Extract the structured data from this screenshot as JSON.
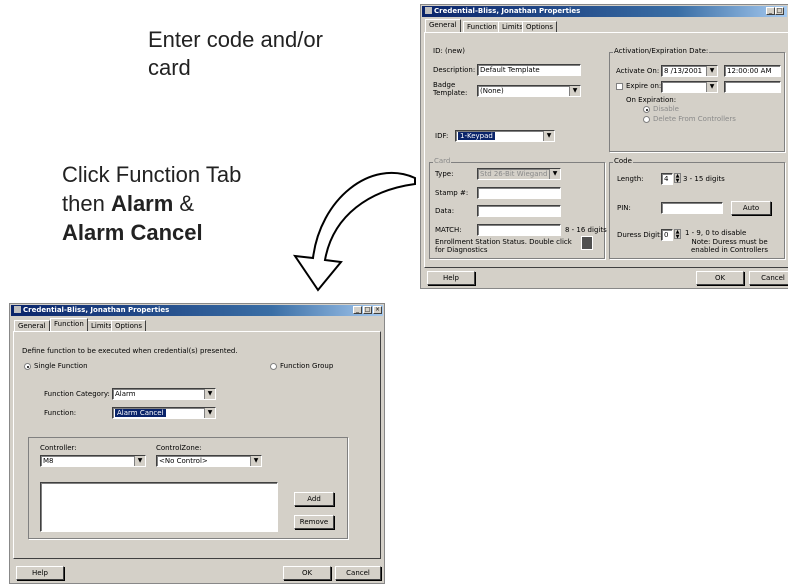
{
  "annotation_top": {
    "line1": "Enter code and/or",
    "line2": "card"
  },
  "annotation_mid": {
    "line1": "Click Function Tab",
    "line2_prefix": "then ",
    "line2_bold": "Alarm",
    "line2_suffix": " &",
    "line3_bold": "Alarm Cancel"
  },
  "general_window": {
    "title": "Credential-Bliss, Jonathan Properties",
    "tabs": [
      "General",
      "Function",
      "Limits",
      "Options"
    ],
    "id_label": "ID: (new)",
    "description_label": "Description:",
    "description_value": "Default Template",
    "badge_label_1": "Badge",
    "badge_label_2": "Template:",
    "badge_value": "(None)",
    "idf_label": "IDF:",
    "idf_value": "1-Keypad",
    "activation_group": "Activation/Expiration Date:",
    "activate_label": "Activate On:",
    "activate_date": "8 /13/2001",
    "activate_time": "12:00:00 AM",
    "expire_label": "Expire on:",
    "on_expiration_label": "On Expiration:",
    "disable_label": "Disable",
    "delete_label": "Delete From Controllers",
    "card_group": "Card",
    "type_label": "Type:",
    "type_value": "Std 26-Bit Wiegand",
    "stamp_label": "Stamp #:",
    "data_label": "Data:",
    "match_label": "MATCH:",
    "match_hint": "8 - 16 digits",
    "enrollment_1": "Enrollment Station Status.  Double click",
    "enrollment_2": "for Diagnostics",
    "code_group": "Code",
    "length_label": "Length:",
    "length_value": "4",
    "length_hint": "3 - 15 digits",
    "pin_label": "PIN:",
    "auto_button": "Auto",
    "duress_label": "Duress Digit:",
    "duress_value": "0",
    "duress_hint": "1 - 9, 0 to disable",
    "duress_note_1": "Note: Duress must be",
    "duress_note_2": "enabled in Controllers",
    "help_button": "Help",
    "ok_button": "OK",
    "cancel_button": "Cancel"
  },
  "function_window": {
    "title": "Credential-Bliss, Jonathan Properties",
    "tabs": [
      "General",
      "Function",
      "Limits",
      "Options"
    ],
    "define_text": "Define function to be executed when credential(s) presented.",
    "single_function": "Single Function",
    "function_group": "Function Group",
    "category_label": "Function Category:",
    "category_value": "Alarm",
    "function_label": "Function:",
    "function_value": "Alarm Cancel",
    "controller_label": "Controller:",
    "controller_value": "M8",
    "controlzone_label": "ControlZone:",
    "controlzone_value": "<No Control>",
    "add_button": "Add",
    "remove_button": "Remove",
    "help_button": "Help",
    "ok_button": "OK",
    "cancel_button": "Cancel"
  },
  "window_controls": {
    "minimize": "_",
    "maximize": "□",
    "close": "×"
  },
  "arrow_glyphs": {
    "down": "▼",
    "up": "▲"
  }
}
